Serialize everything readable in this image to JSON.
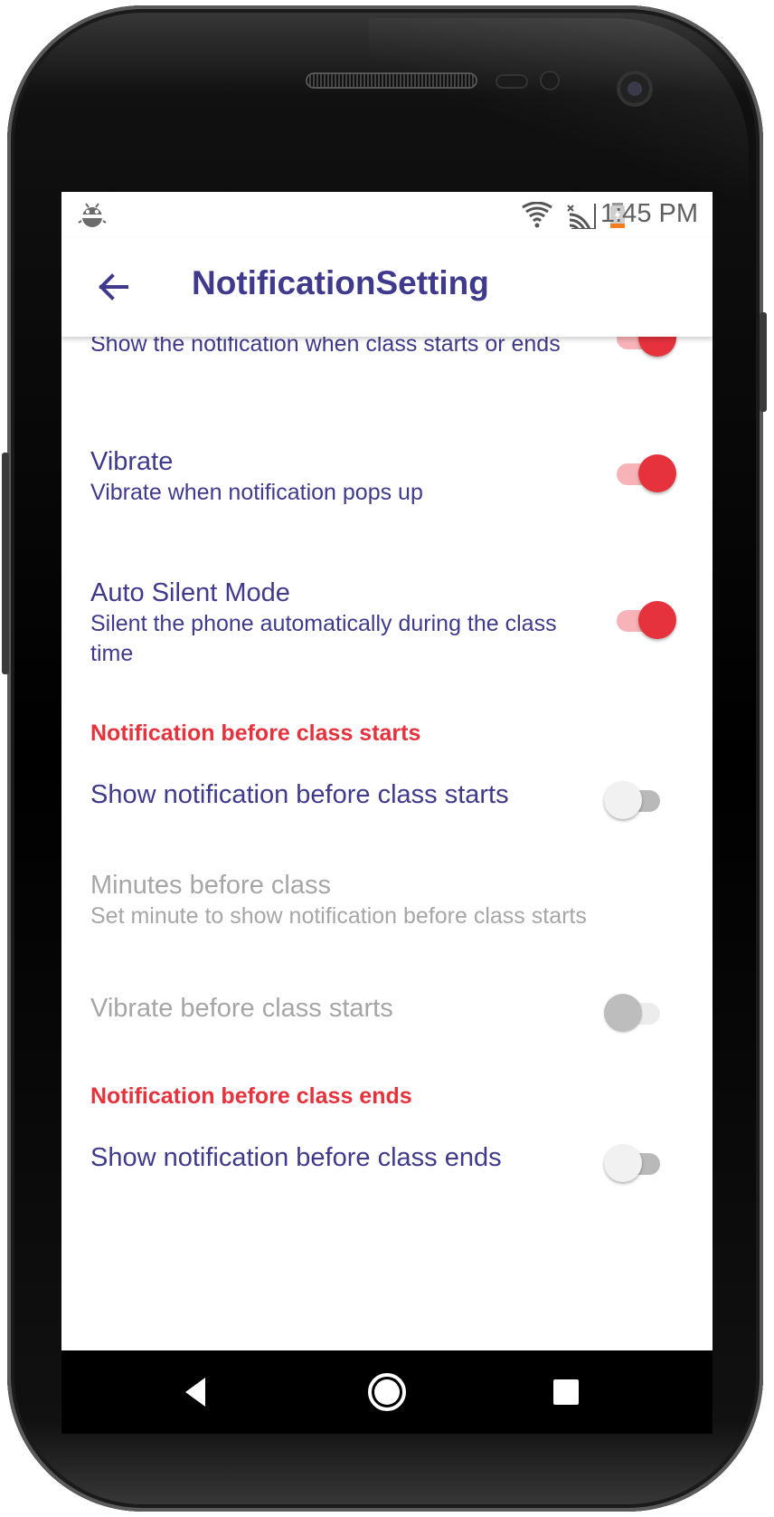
{
  "status_bar": {
    "time": "1:45 PM",
    "icons": [
      "debug-bug-icon",
      "wifi-icon",
      "signal-no-sim-icon",
      "battery-charging-icon"
    ]
  },
  "app_bar": {
    "title": "NotificationSetting",
    "back_icon": "arrow-left-icon"
  },
  "settings": {
    "class_notification": {
      "summary": "Show the notification when class starts or ends",
      "checked": true
    },
    "vibrate": {
      "title": "Vibrate",
      "summary": "Vibrate when notification pops up",
      "checked": true
    },
    "auto_silent": {
      "title": "Auto Silent Mode",
      "summary": "Silent the phone automatically during the class time",
      "checked": true
    },
    "category_start": "Notification before class starts",
    "show_before_start": {
      "title": "Show notification before class starts",
      "checked": false
    },
    "minutes_before": {
      "title": "Minutes before class",
      "summary": "Set minute to show notification before class starts",
      "enabled": false
    },
    "vibrate_before_start": {
      "title": "Vibrate before class starts",
      "checked": false,
      "enabled": false
    },
    "category_end": "Notification before class ends",
    "show_before_end": {
      "title": "Show notification before class ends",
      "checked": false
    }
  },
  "nav_bar": {
    "icons": [
      "back-triangle-icon",
      "home-circle-icon",
      "recents-square-icon"
    ]
  },
  "colors": {
    "primary_text": "#3f3a8c",
    "accent": "#e5323c",
    "disabled_text": "#a6a6a6"
  }
}
